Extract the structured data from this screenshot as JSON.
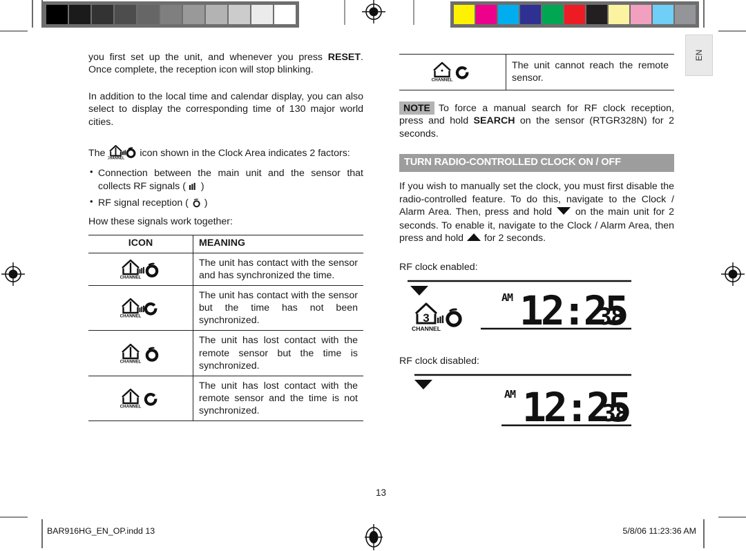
{
  "document": {
    "page_number": "13",
    "language_tab": "EN",
    "footer_left": "BAR916HG_EN_OP.indd   13",
    "footer_right": "5/8/06   11:23:36 AM"
  },
  "calibration": {
    "grayscale_label": "grayscale-calibration-strip",
    "grayscale_chips": [
      "#000000",
      "#1b1b1b",
      "#333333",
      "#4d4d4d",
      "#666666",
      "#7f7f7f",
      "#999999",
      "#b3b3b3",
      "#cccccc",
      "#ebebeb",
      "#ffffff"
    ],
    "color_label": "color-calibration-strip",
    "color_chips": [
      "#fff200",
      "#ec008c",
      "#00aeef",
      "#2e3192",
      "#00a651",
      "#ed1c24",
      "#231f20",
      "#fbf3a0",
      "#f2a0c0",
      "#6fcff6",
      "#939598"
    ]
  },
  "left_column": {
    "para1_pre": "you first set up the unit, and whenever you press ",
    "para1_bold": "RESET",
    "para1_post": ". Once complete, the reception icon will stop blinking.",
    "para2": "In addition to the local time and calendar display, you can also select to display the corresponding time of 130 major world cities.",
    "para3_pre": "The ",
    "para3_post": " icon shown in the Clock Area indicates 2 factors:",
    "bullet1_pre": "Connection between the main unit and the sensor that collects RF signals ( ",
    "bullet1_post": " )",
    "bullet2_pre": "RF signal reception ( ",
    "bullet2_post": " )",
    "para4": "How these signals work together:",
    "table": {
      "headers": [
        "ICON",
        "MEANING"
      ],
      "rows": [
        {
          "icon": "icon-house-signal-reception-full",
          "meaning": "The unit has contact with the sensor and has synchronized the time."
        },
        {
          "icon": "icon-house-signal-reception-empty",
          "meaning": "The unit has contact with the sensor but the time has not been synchronized."
        },
        {
          "icon": "icon-house-nosignal-reception-full",
          "meaning": "The unit has lost contact with the remote sensor but the time is synchronized."
        },
        {
          "icon": "icon-house-nosignal-reception-empty",
          "meaning": "The unit has lost contact with the remote sensor and the time is not synchronized."
        }
      ]
    }
  },
  "right_column": {
    "mini_table": {
      "rows": [
        {
          "icon": "icon-house-empty-reception-empty",
          "meaning": "The unit cannot reach the remote sensor."
        }
      ]
    },
    "note": {
      "badge": "NOTE",
      "text_pre": "To force a manual search for RF clock reception, press and hold ",
      "text_bold": "SEARCH",
      "text_post": " on the sensor (RTGR328N) for 2 seconds."
    },
    "section_heading": "TURN RADIO-CONTROLLED CLOCK ON / OFF",
    "body_1": "If you wish to manually set the clock, you must first disable the radio-controlled feature. To do this, navigate to the Clock / Alarm Area. Then, press and hold ",
    "body_2": " on the main unit for 2 seconds. To enable it, navigate to the Clock / Alarm Area, then press and hold ",
    "body_3": " for 2 seconds.",
    "figure_enabled_label": "RF clock enabled:",
    "figure_disabled_label": "RF clock disabled:",
    "lcd": {
      "meridiem": "AM",
      "hours": "12",
      "minutes": "25",
      "seconds": "38",
      "channel_label": "CHANNEL",
      "channel_number": "3"
    }
  },
  "colors": {
    "heading_bar": "#9d9d9d",
    "note_badge": "#b3b3b3",
    "rule": "#222222",
    "text": "#1a1a1a"
  }
}
